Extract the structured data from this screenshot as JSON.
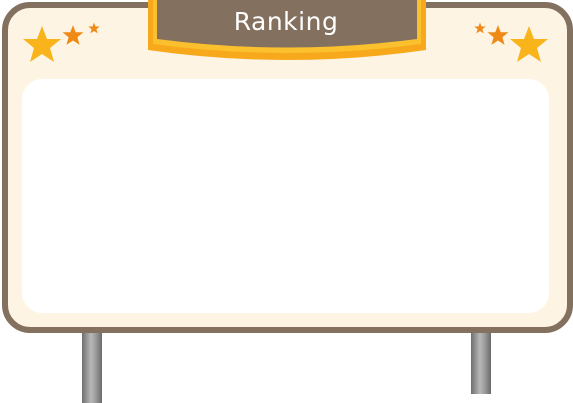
{
  "banner": {
    "title": "Ranking"
  },
  "icons": [
    "star-icon"
  ],
  "colors": {
    "frame": "#84705f",
    "board": "#fdf4e4",
    "banner_fill": "#84705f",
    "banner_border": "#f7a81b",
    "star_yellow": "#f9b41c",
    "star_orange": "#ef8a17"
  }
}
